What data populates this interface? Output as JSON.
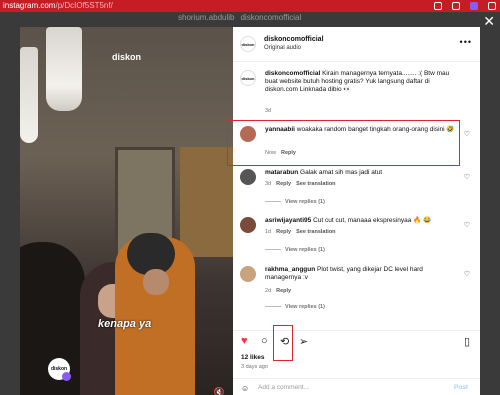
{
  "browser": {
    "url_host": "instagram.com",
    "url_path": "/p/DcIOf5ST5nf/"
  },
  "backdrop": {
    "user1": "shorium.abdulib",
    "user2": "diskoncomofficial"
  },
  "video": {
    "logo_text": "diskon",
    "caption": "kenapa ya",
    "badge_text": "diskon"
  },
  "post": {
    "header": {
      "username": "diskoncomofficial",
      "subtitle": "Original audio"
    },
    "caption": {
      "username": "diskoncomofficial",
      "text": "Kirain managernya ternyata........ :( Btw mau buat website butuh hosting gratis? Yuk langsung daftar di diskon.com Linknada dibio 👀",
      "time": "3d"
    },
    "comments": [
      {
        "username": "yannaabii",
        "text": "woakaka random banget tingkah orang-orang disini 🤣",
        "time": "Now",
        "reply": "Reply",
        "translate": "",
        "replies": ""
      },
      {
        "username": "matarabun",
        "text": "Galak amat sih mas jadi atut",
        "time": "3d",
        "reply": "Reply",
        "translate": "See translation",
        "replies": "View replies (1)"
      },
      {
        "username": "asriwijayanti95",
        "text": "Cut cut cut, manaaa ekspresinyaa 🔥 😂",
        "time": "1d",
        "reply": "Reply",
        "translate": "See translation",
        "replies": "View replies (1)"
      },
      {
        "username": "rakhma_anggun",
        "text": "Plot twist, yang dikejar DC level hard managernya :v",
        "time": "2d",
        "reply": "Reply",
        "translate": "",
        "replies": "View replies (1)"
      }
    ],
    "likes": "12 likes",
    "posted": "3 days ago",
    "add_comment_placeholder": "Add a comment...",
    "post_label": "Post"
  },
  "colors": {
    "urlbar": "#c41d25",
    "highlight": "#e0232e",
    "like_heart": "#ff3040"
  },
  "icons": [
    "close-icon",
    "more-icon",
    "heart-icon",
    "comment-icon",
    "repost-icon",
    "share-icon",
    "bookmark-icon",
    "emoji-icon",
    "mute-icon"
  ]
}
